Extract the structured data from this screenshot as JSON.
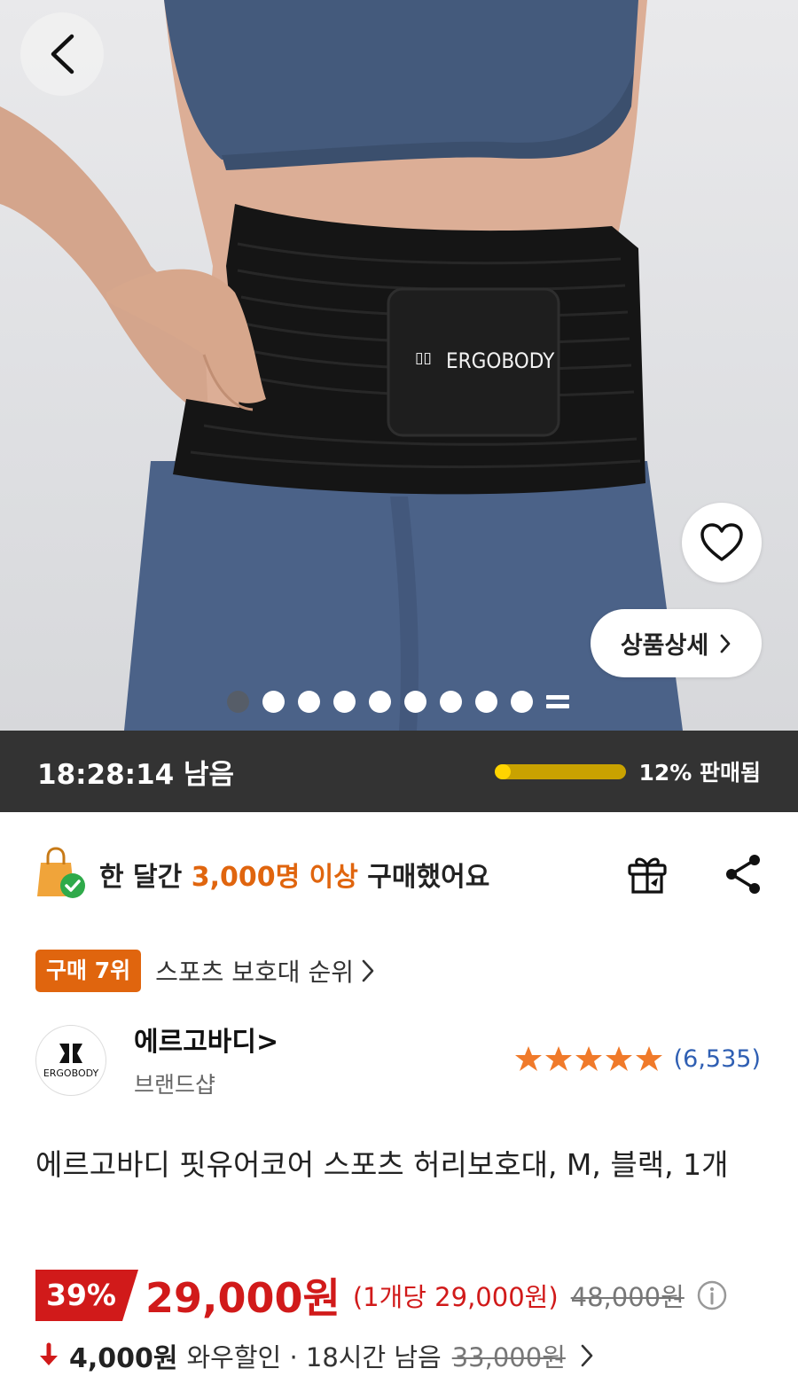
{
  "hero": {
    "brand_logo_text": "ERGOBODY",
    "detail_button_label": "상품상세",
    "carousel": {
      "total_dots": 9,
      "active_index": 0
    }
  },
  "deal": {
    "time_left": "18:28:14 남음",
    "sold_percent": 12,
    "sold_label": "12% 판매됨"
  },
  "buyers": {
    "prefix": "한 달간 ",
    "highlight": "3,000명 이상",
    "suffix": " 구매했어요"
  },
  "rank": {
    "badge": "구매 7위",
    "link": "스포츠 보호대 순위"
  },
  "brand": {
    "logo_text": "ERGOBODY",
    "name": "에르고바디>",
    "subtitle": "브랜드샵",
    "rating_stars": 5,
    "review_count": "(6,535)"
  },
  "product": {
    "title": "에르고바디 핏유어코어 스포츠 허리보호대, M, 블랙, 1개"
  },
  "price": {
    "discount": "39%",
    "sale_price": "29,000원",
    "unit_price": "(1개당 29,000원)",
    "original_price": "48,000원"
  },
  "wow": {
    "amount": "4,000원",
    "label": "와우할인 · 18시간 남음",
    "original": "33,000원"
  },
  "colors": {
    "accent_orange": "#e0650e",
    "price_red": "#d11a1a",
    "star": "#f07a2a",
    "review_blue": "#2f5fb3",
    "timer_bg": "#333333",
    "progress_fill": "#ffd400"
  }
}
